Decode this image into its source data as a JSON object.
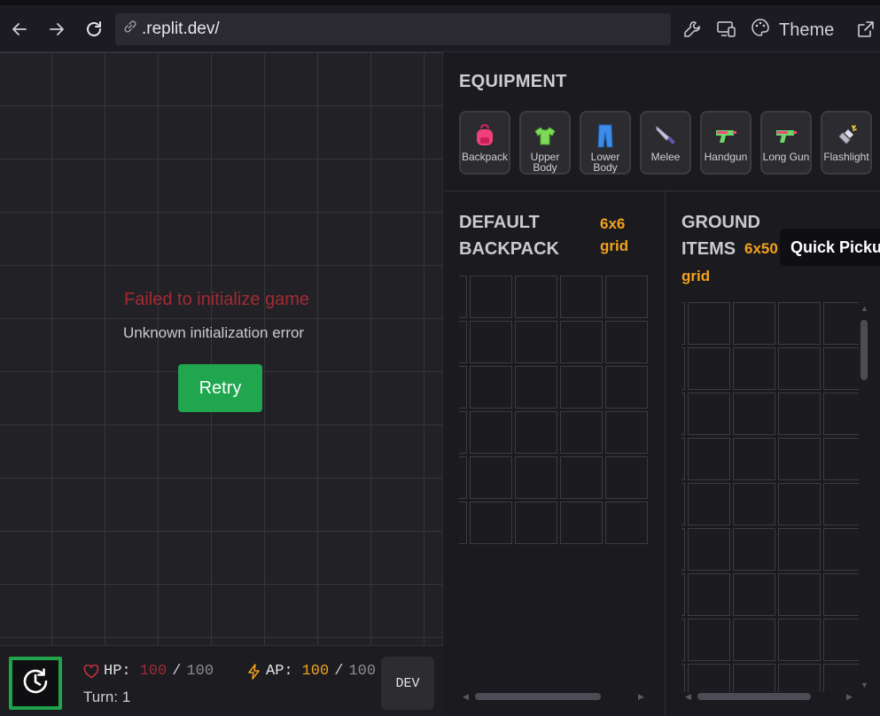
{
  "browser": {
    "url": ".replit.dev/",
    "theme_label": "Theme"
  },
  "game": {
    "error_title": "Failed to initialize game",
    "error_message": "Unknown initialization error",
    "retry_label": "Retry"
  },
  "hud": {
    "hp_label": "HP:",
    "hp_current": "100",
    "hp_max": "100",
    "ap_label": "AP:",
    "ap_current": "100",
    "ap_max": "100",
    "turn_label": "Turn: 1",
    "dev_label": "DEV",
    "colors": {
      "hp": "#9e2b33",
      "ap": "#f1a21d",
      "turn_button_border": "#20a34a"
    }
  },
  "equipment": {
    "title": "EQUIPMENT",
    "slots": [
      {
        "label": "Backpack",
        "icon": "backpack-icon"
      },
      {
        "label": "Upper Body",
        "icon": "shirt-icon"
      },
      {
        "label": "Lower Body",
        "icon": "jeans-icon"
      },
      {
        "label": "Melee",
        "icon": "knife-icon"
      },
      {
        "label": "Handgun",
        "icon": "water-pistol-icon"
      },
      {
        "label": "Long Gun",
        "icon": "water-pistol-icon"
      },
      {
        "label": "Flashlight",
        "icon": "flashlight-icon"
      }
    ]
  },
  "backpack": {
    "title": "DEFAULT BACKPACK",
    "title_line1": "DEFAULT",
    "title_line2": "BACKPACK",
    "dims_line1": "6x6",
    "dims_line2": "grid"
  },
  "ground": {
    "title_line1": "GROUND",
    "title_line2": "ITEMS",
    "dims_line1": "6x50",
    "dims_line2": "grid",
    "tooltip": "Quick Picku"
  }
}
